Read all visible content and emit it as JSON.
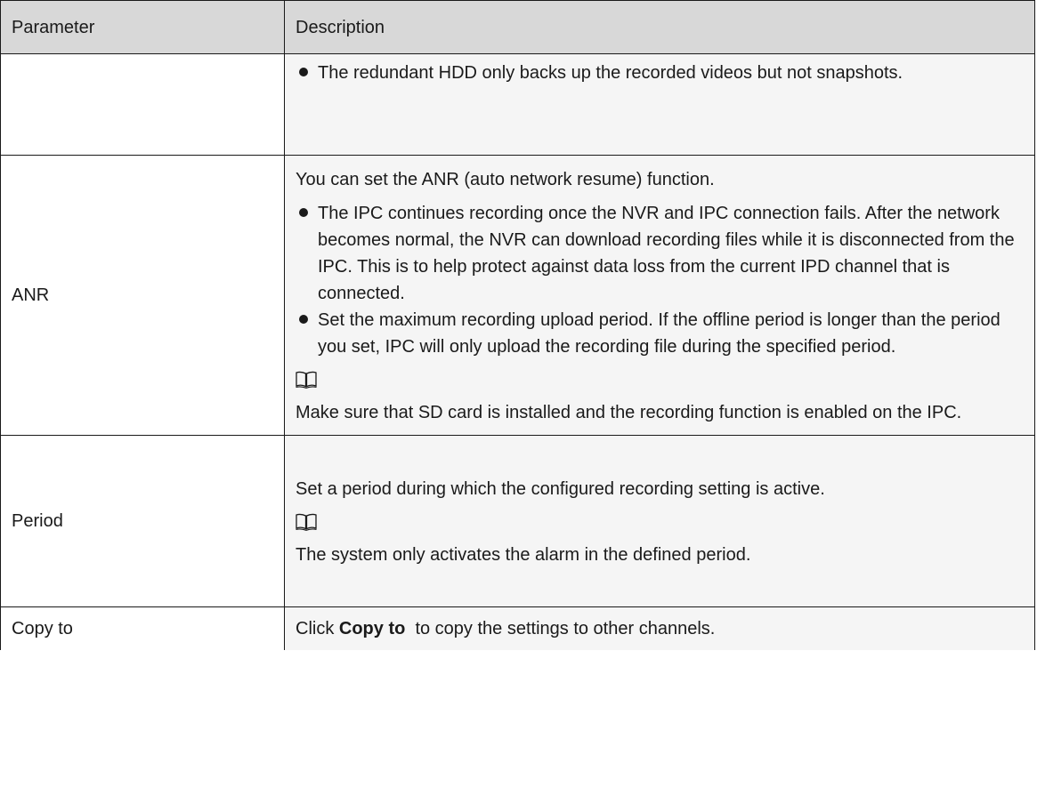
{
  "table": {
    "headers": {
      "parameter": "Parameter",
      "description": "Description"
    },
    "hdd_row": {
      "parameter": "",
      "bullets": [
        "The redundant HDD only backs up the recorded videos but not snapshots."
      ]
    },
    "anr_row": {
      "parameter": "ANR",
      "intro": "You can set the ANR (auto network resume) function.",
      "bullets": [
        "The IPC continues recording once the NVR and IPC connection fails. After the network becomes normal, the NVR can download recording files while it is disconnected from the IPC. This is to help protect against data loss from the current IPD channel that is connected.",
        "Set the maximum recording upload period. If the offline period is longer than the period you set, IPC will only upload the recording file during the specified period."
      ],
      "note_icon": "book-icon",
      "note": "Make sure that SD card is installed and the recording function is enabled on the IPC."
    },
    "period_row": {
      "parameter": "Period",
      "intro": "Set a period during which the configured recording setting is active.",
      "note_icon": "book-icon",
      "note": "The system only activates the alarm in the defined period."
    },
    "copy_row": {
      "parameter": "Copy to",
      "text_before": "Click ",
      "bold": "Copy to",
      "text_after": "  to copy the settings to other channels."
    }
  }
}
